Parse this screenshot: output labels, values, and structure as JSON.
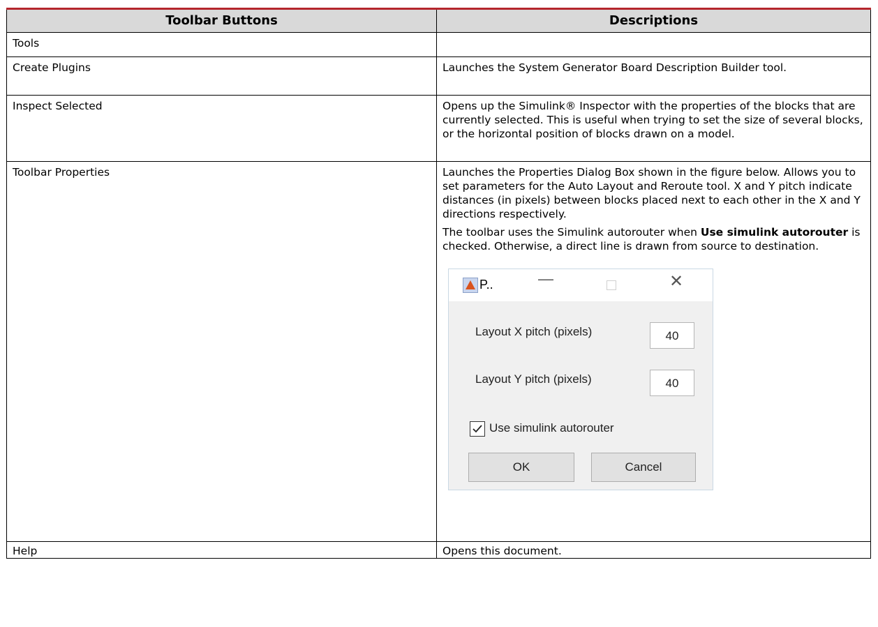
{
  "table": {
    "headers": [
      "Toolbar Buttons",
      "Descriptions"
    ],
    "rows": [
      {
        "button": "Tools",
        "desc": ""
      },
      {
        "button": "Create Plugins",
        "desc": "Launches the System Generator Board Description Builder tool."
      },
      {
        "button": "Inspect Selected",
        "desc": "Opens up the Simulink® Inspector with the properties of the blocks that are currently selected. This is useful when trying to set the size of several blocks, or the horizontal position of blocks drawn on a model."
      },
      {
        "button": "Toolbar Properties",
        "desc": "Launches the Properties Dialog Box shown in the figure below. Allows you to set parameters for the Auto Layout and Reroute tool. X and Y pitch indicate distances (in pixels) between blocks placed next to each other in the X and Y directions respectively.",
        "desc2_pre": "The toolbar uses the Simulink autorouter when ",
        "desc2_bold": "Use simulink autorouter",
        "desc2_post": " is checked. Otherwise, a direct line is drawn from source to destination."
      },
      {
        "button": "Help",
        "desc": "Opens this document."
      }
    ]
  },
  "dialog": {
    "title": "P..",
    "minimize_glyph": "—",
    "close_glyph": "✕",
    "x_pitch_label": "Layout X pitch (pixels)",
    "x_pitch_value": "40",
    "y_pitch_label": "Layout Y pitch (pixels)",
    "y_pitch_value": "40",
    "checkbox_label": "Use simulink autorouter",
    "checkbox_checked": true,
    "ok_label": "OK",
    "cancel_label": "Cancel",
    "icon": "matlab-icon"
  }
}
